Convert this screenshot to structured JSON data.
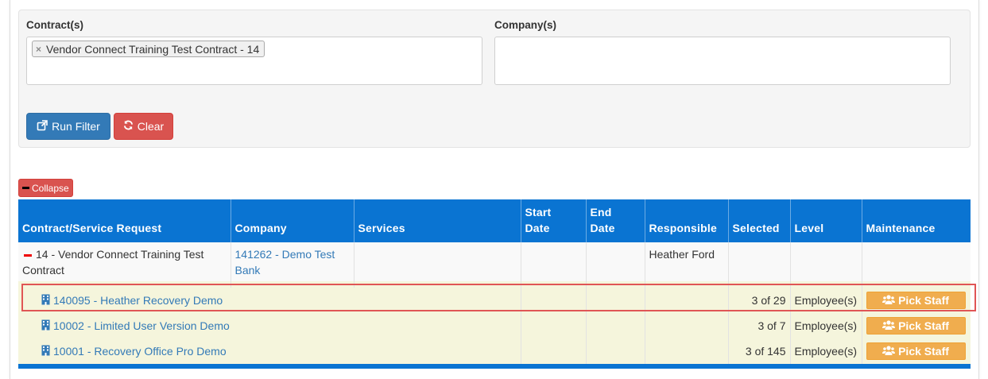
{
  "filters": {
    "contracts_label": "Contract(s)",
    "contract_tag": "Vendor Connect Training Test Contract - 14",
    "companies_label": "Company(s)"
  },
  "buttons": {
    "run_filter": "Run Filter",
    "clear": "Clear",
    "collapse": "Collapse"
  },
  "table": {
    "headers": {
      "contract": "Contract/Service Request",
      "company": "Company",
      "services": "Services",
      "start_date_1": "Start",
      "start_date_2": "Date",
      "end_date_1": "End",
      "end_date_2": "Date",
      "responsible": "Responsible",
      "selected": "Selected",
      "level": "Level",
      "maintenance": "Maintenance"
    },
    "parent": {
      "contract": "14 - Vendor Connect Training Test Contract",
      "company": "141262 - Demo Test Bank",
      "responsible": "Heather Ford"
    },
    "children": [
      {
        "name": "140095 - Heather Recovery Demo",
        "selected": "3 of 29",
        "level": "Employee(s)",
        "action": "Pick Staff"
      },
      {
        "name": "10002 - Limited User Version Demo",
        "selected": "3 of 7",
        "level": "Employee(s)",
        "action": "Pick Staff"
      },
      {
        "name": "10001 - Recovery Office Pro Demo",
        "selected": "3 of 145",
        "level": "Employee(s)",
        "action": "Pick Staff"
      }
    ]
  },
  "colors": {
    "header_blue": "#0a74d2",
    "link_blue": "#337ab7",
    "danger_red": "#d9534f",
    "warning_orange": "#f0ad4e",
    "child_row_bg": "#f5f5dc",
    "highlight_red": "#e05555"
  },
  "icons": {
    "run_filter": "external-link-icon",
    "clear": "refresh-icon",
    "collapse": "minus-icon",
    "row": "building-icon",
    "pick_staff": "users-icon"
  }
}
